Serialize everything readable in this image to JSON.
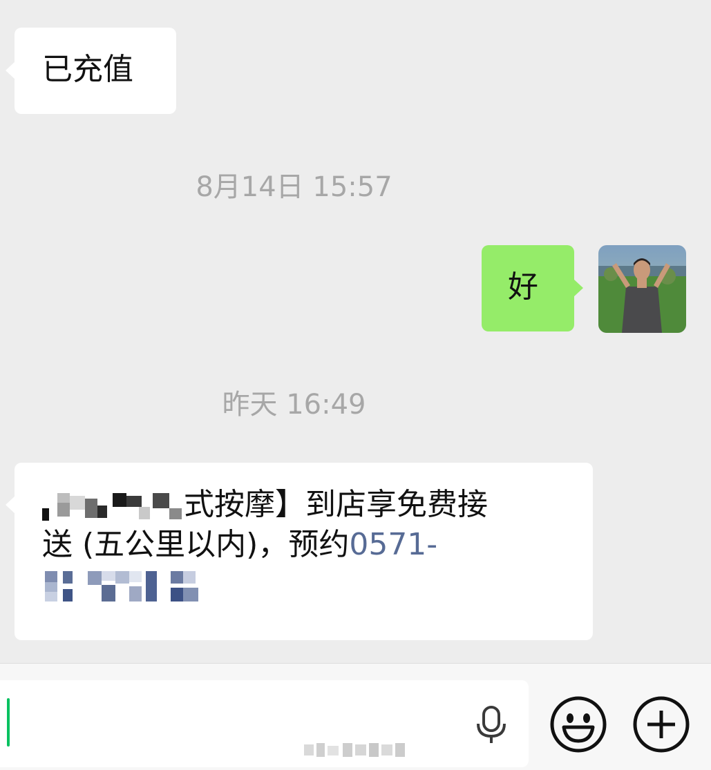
{
  "messages": [
    {
      "side": "left",
      "text": "已充值"
    },
    {
      "side": "right",
      "text": "好"
    },
    {
      "side": "left",
      "text_head": "式按摩】到店享免费接",
      "text_line2": "送 (五公里以内)，预约",
      "phone_prefix": "0571-"
    }
  ],
  "timestamps": [
    "8月14日 15:57",
    "昨天 16:49"
  ],
  "input": {
    "value": ""
  },
  "icons": [
    "microphone-icon",
    "emoji-icon",
    "plus-icon"
  ],
  "colors": {
    "background": "#ededed",
    "incoming_bubble": "#ffffff",
    "outgoing_bubble": "#95ec69",
    "link": "#576b95",
    "timestamp": "#a7a7a7",
    "cursor": "#07c160"
  }
}
